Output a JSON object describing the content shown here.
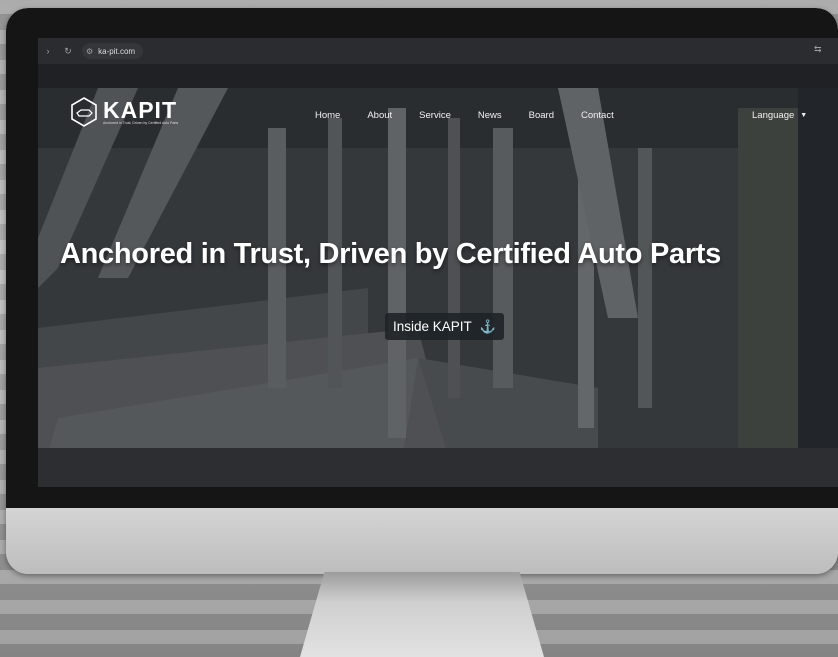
{
  "browser": {
    "url": "ka-pit.com"
  },
  "site": {
    "logo": {
      "name": "KAPIT",
      "tagline": "Anchored in Trust, Driven by Certified Auto Parts"
    },
    "nav": [
      "Home",
      "About",
      "Service",
      "News",
      "Board",
      "Contact"
    ],
    "language_label": "Language",
    "hero_headline": "Anchored in Trust, Driven by Certified Auto Parts",
    "cta_label": "Inside KAPIT"
  },
  "icons": {
    "browser": [
      "back-icon",
      "reload-icon",
      "site-settings-icon",
      "translate-icon"
    ],
    "cta": "anchor-icon",
    "language": "chevron-down-icon"
  },
  "colors": {
    "cta_icon": "#3b9ce0",
    "cta_background": "#1e2228"
  }
}
